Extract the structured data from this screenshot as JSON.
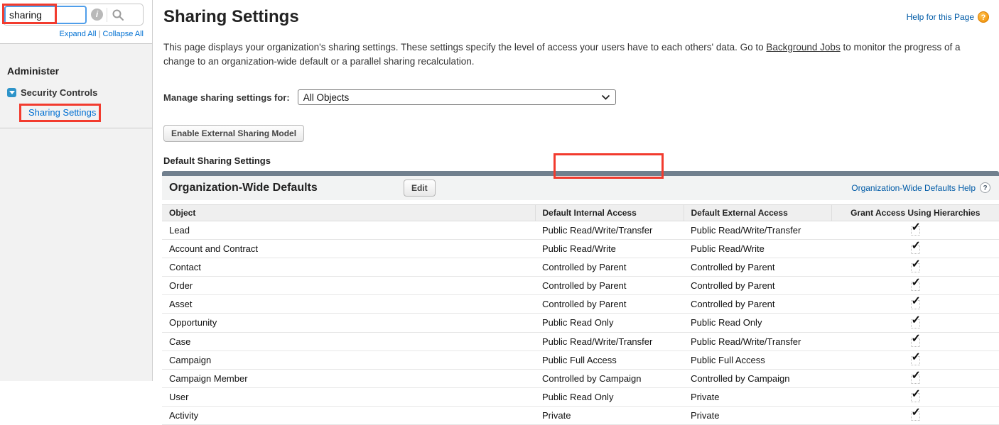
{
  "sidebar": {
    "search": {
      "value": "sharing",
      "info_icon": "i",
      "search_icon": "magnifier"
    },
    "expand_all": "Expand All",
    "link_separator": "|",
    "collapse_all": "Collapse All",
    "section_heading": "Administer",
    "tree_node": "Security Controls",
    "tree_child": "Sharing Settings"
  },
  "header": {
    "title": "Sharing Settings",
    "help_link": "Help for this Page",
    "help_icon": "?",
    "description_pre": "This page displays your organization's sharing settings. These settings specify the level of access your users have to each others' data. Go to ",
    "description_link": "Background Jobs",
    "description_post": " to monitor the progress of a change to an organization-wide default or a parallel sharing recalculation."
  },
  "controls": {
    "manage_label": "Manage sharing settings for:",
    "manage_value": "All Objects",
    "enable_button": "Enable External Sharing Model"
  },
  "section": {
    "group_heading": "Default Sharing Settings",
    "title": "Organization-Wide Defaults",
    "edit_button": "Edit",
    "help_link": "Organization-Wide Defaults Help",
    "help_icon": "?"
  },
  "table": {
    "columns": [
      "Object",
      "Default Internal Access",
      "Default External Access",
      "Grant Access Using Hierarchies"
    ],
    "check_glyph": "✓",
    "rows": [
      {
        "object": "Lead",
        "internal": "Public Read/Write/Transfer",
        "external": "Public Read/Write/Transfer",
        "grant": true
      },
      {
        "object": "Account and Contract",
        "internal": "Public Read/Write",
        "external": "Public Read/Write",
        "grant": true
      },
      {
        "object": "Contact",
        "internal": "Controlled by Parent",
        "external": "Controlled by Parent",
        "grant": true
      },
      {
        "object": "Order",
        "internal": "Controlled by Parent",
        "external": "Controlled by Parent",
        "grant": true
      },
      {
        "object": "Asset",
        "internal": "Controlled by Parent",
        "external": "Controlled by Parent",
        "grant": true
      },
      {
        "object": "Opportunity",
        "internal": "Public Read Only",
        "external": "Public Read Only",
        "grant": true
      },
      {
        "object": "Case",
        "internal": "Public Read/Write/Transfer",
        "external": "Public Read/Write/Transfer",
        "grant": true
      },
      {
        "object": "Campaign",
        "internal": "Public Full Access",
        "external": "Public Full Access",
        "grant": true
      },
      {
        "object": "Campaign Member",
        "internal": "Controlled by Campaign",
        "external": "Controlled by Campaign",
        "grant": true
      },
      {
        "object": "User",
        "internal": "Public Read Only",
        "external": "Private",
        "grant": true
      },
      {
        "object": "Activity",
        "internal": "Private",
        "external": "Private",
        "grant": true
      }
    ]
  },
  "colors": {
    "annotation_red": "#f23b2e",
    "section_bar": "#71808e",
    "main_link_blue": "#015ba7",
    "sidebar_link_blue": "#0070d2",
    "toggle_blue": "#2e94c9",
    "help_icon_orange": "#ef8d00",
    "search_focus_blue": "#4f9eea"
  }
}
